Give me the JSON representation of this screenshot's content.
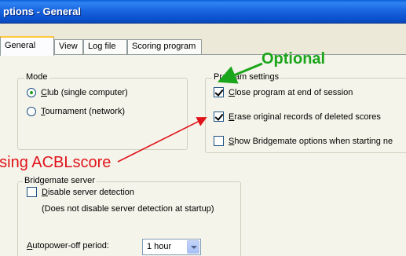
{
  "window": {
    "title": "ptions - General"
  },
  "tabs": [
    {
      "label": "General",
      "active": true
    },
    {
      "label": "View",
      "active": false
    },
    {
      "label": "Log file",
      "active": false
    },
    {
      "label": "Scoring program",
      "active": false
    }
  ],
  "mode": {
    "label": "Mode",
    "options": [
      {
        "label": "Club (single computer)",
        "selected": true
      },
      {
        "label": "Tournament (network)",
        "selected": false
      }
    ]
  },
  "program_settings": {
    "label": "Program settings",
    "options": [
      {
        "label": "Close program at end of session",
        "checked": true
      },
      {
        "label": "Erase original records of deleted scores",
        "checked": true
      },
      {
        "label": "Show Bridgemate options when starting ne",
        "checked": false
      }
    ]
  },
  "bridgemate_server": {
    "label": "Bridgemate server",
    "disable_detection": {
      "label": "Disable server detection",
      "checked": false
    },
    "note": "(Does not disable server detection at startup)",
    "autopower": {
      "label": "Autopower-off period:",
      "value": "1 hour"
    }
  },
  "annotations": {
    "optional": {
      "text": "Optional",
      "color": "#1aa51a"
    },
    "acblscore": {
      "text": "using ACBLscore",
      "color": "#e0131b"
    }
  }
}
